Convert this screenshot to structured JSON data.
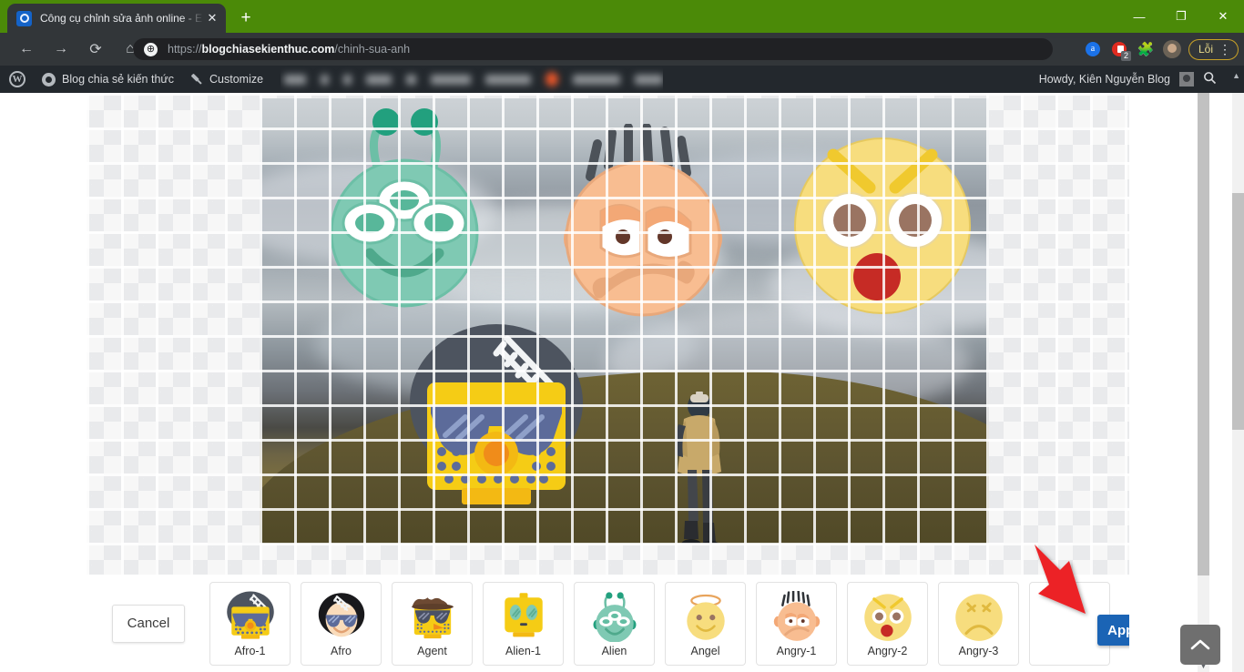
{
  "browser": {
    "tab": {
      "title": "Công cụ chỉnh sửa ảnh online - E",
      "close_label": "✕",
      "favicon": "globe-blue-icon"
    },
    "new_tab_label": "+",
    "window_controls": {
      "minimize": "—",
      "maximize": "❐",
      "close": "✕"
    },
    "nav": {
      "back": "←",
      "forward": "→",
      "reload": "⟳",
      "home": "⌂"
    },
    "omnibox": {
      "site_icon": "globe-icon",
      "scheme": "https://",
      "host": "blogchiasekienthuc.com",
      "path": "/chinh-sua-anh",
      "full_url": "https://blogchiasekienthuc.com/chinh-sua-anh"
    },
    "toolbar_icons": {
      "adblock_letter": "a",
      "recorder_badge": "2",
      "extensions": "puzzle-piece-icon",
      "profile": "profile-avatar-icon",
      "error_pill_label": "Lỗi",
      "menu": "⋮"
    }
  },
  "wp_admin_bar": {
    "logo": "W",
    "site_name": "Blog chia sẻ kiến thức",
    "customize": "Customize",
    "howdy": "Howdy, Kiên Nguyễn Blog",
    "search": "search-icon",
    "collapse": "▲"
  },
  "editor": {
    "canvas": {
      "photo_alt": "person standing on mountain ridge above clouds",
      "placed_stickers": [
        "Alien",
        "Angry-1",
        "Angry-2",
        "Afro-1"
      ]
    },
    "cancel_label": "Cancel",
    "apply_label": "Apply",
    "stickers": [
      {
        "name": "Afro-1",
        "icon": "afro-1-sticker"
      },
      {
        "name": "Afro",
        "icon": "afro-sticker"
      },
      {
        "name": "Agent",
        "icon": "agent-sticker"
      },
      {
        "name": "Alien-1",
        "icon": "alien-1-sticker"
      },
      {
        "name": "Alien",
        "icon": "alien-sticker"
      },
      {
        "name": "Angel",
        "icon": "angel-sticker"
      },
      {
        "name": "Angry-1",
        "icon": "angry-1-sticker"
      },
      {
        "name": "Angry-2",
        "icon": "angry-2-sticker"
      },
      {
        "name": "Angry-3",
        "icon": "angry-3-sticker"
      }
    ]
  },
  "annotation": {
    "arrow": "red-arrow-pointing-to-apply"
  },
  "back_to_top": {
    "icon": "chevron-up-icon"
  },
  "colors": {
    "titlebar_green": "#4b8a08",
    "chrome_dark": "#323639",
    "wp_dark": "#23282d",
    "apply_blue": "#1b64b5",
    "arrow_red": "#ec2227"
  }
}
